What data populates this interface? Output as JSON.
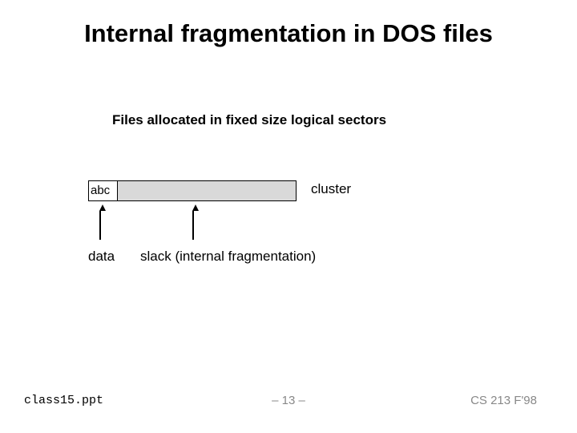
{
  "title": "Internal fragmentation in DOS files",
  "subtitle": "Files allocated in fixed size logical sectors",
  "diagram": {
    "data_content": "abc",
    "cluster_label": "cluster",
    "data_label": "data",
    "slack_label": "slack (internal fragmentation)"
  },
  "footer": {
    "file": "class15.ppt",
    "page": "– 13 –",
    "course": "CS 213 F'98"
  }
}
